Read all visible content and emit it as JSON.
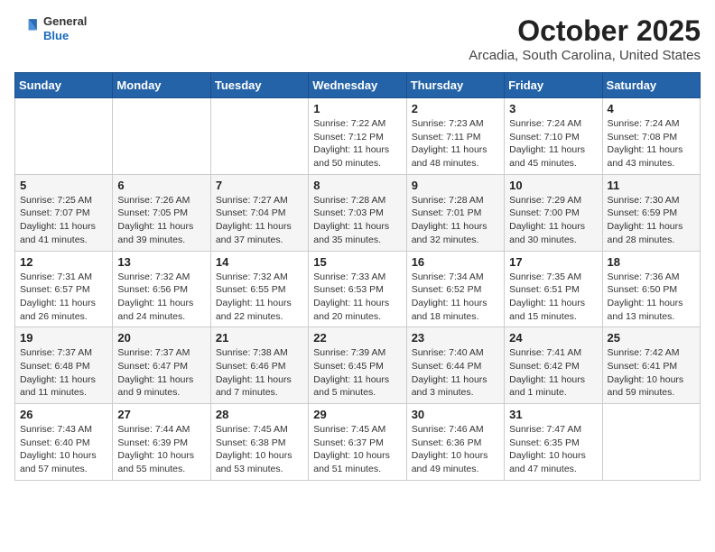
{
  "header": {
    "logo": {
      "general": "General",
      "blue": "Blue"
    },
    "title": "October 2025",
    "location": "Arcadia, South Carolina, United States"
  },
  "weekdays": [
    "Sunday",
    "Monday",
    "Tuesday",
    "Wednesday",
    "Thursday",
    "Friday",
    "Saturday"
  ],
  "weeks": [
    [
      {
        "day": "",
        "info": ""
      },
      {
        "day": "",
        "info": ""
      },
      {
        "day": "",
        "info": ""
      },
      {
        "day": "1",
        "info": "Sunrise: 7:22 AM\nSunset: 7:12 PM\nDaylight: 11 hours and 50 minutes."
      },
      {
        "day": "2",
        "info": "Sunrise: 7:23 AM\nSunset: 7:11 PM\nDaylight: 11 hours and 48 minutes."
      },
      {
        "day": "3",
        "info": "Sunrise: 7:24 AM\nSunset: 7:10 PM\nDaylight: 11 hours and 45 minutes."
      },
      {
        "day": "4",
        "info": "Sunrise: 7:24 AM\nSunset: 7:08 PM\nDaylight: 11 hours and 43 minutes."
      }
    ],
    [
      {
        "day": "5",
        "info": "Sunrise: 7:25 AM\nSunset: 7:07 PM\nDaylight: 11 hours and 41 minutes."
      },
      {
        "day": "6",
        "info": "Sunrise: 7:26 AM\nSunset: 7:05 PM\nDaylight: 11 hours and 39 minutes."
      },
      {
        "day": "7",
        "info": "Sunrise: 7:27 AM\nSunset: 7:04 PM\nDaylight: 11 hours and 37 minutes."
      },
      {
        "day": "8",
        "info": "Sunrise: 7:28 AM\nSunset: 7:03 PM\nDaylight: 11 hours and 35 minutes."
      },
      {
        "day": "9",
        "info": "Sunrise: 7:28 AM\nSunset: 7:01 PM\nDaylight: 11 hours and 32 minutes."
      },
      {
        "day": "10",
        "info": "Sunrise: 7:29 AM\nSunset: 7:00 PM\nDaylight: 11 hours and 30 minutes."
      },
      {
        "day": "11",
        "info": "Sunrise: 7:30 AM\nSunset: 6:59 PM\nDaylight: 11 hours and 28 minutes."
      }
    ],
    [
      {
        "day": "12",
        "info": "Sunrise: 7:31 AM\nSunset: 6:57 PM\nDaylight: 11 hours and 26 minutes."
      },
      {
        "day": "13",
        "info": "Sunrise: 7:32 AM\nSunset: 6:56 PM\nDaylight: 11 hours and 24 minutes."
      },
      {
        "day": "14",
        "info": "Sunrise: 7:32 AM\nSunset: 6:55 PM\nDaylight: 11 hours and 22 minutes."
      },
      {
        "day": "15",
        "info": "Sunrise: 7:33 AM\nSunset: 6:53 PM\nDaylight: 11 hours and 20 minutes."
      },
      {
        "day": "16",
        "info": "Sunrise: 7:34 AM\nSunset: 6:52 PM\nDaylight: 11 hours and 18 minutes."
      },
      {
        "day": "17",
        "info": "Sunrise: 7:35 AM\nSunset: 6:51 PM\nDaylight: 11 hours and 15 minutes."
      },
      {
        "day": "18",
        "info": "Sunrise: 7:36 AM\nSunset: 6:50 PM\nDaylight: 11 hours and 13 minutes."
      }
    ],
    [
      {
        "day": "19",
        "info": "Sunrise: 7:37 AM\nSunset: 6:48 PM\nDaylight: 11 hours and 11 minutes."
      },
      {
        "day": "20",
        "info": "Sunrise: 7:37 AM\nSunset: 6:47 PM\nDaylight: 11 hours and 9 minutes."
      },
      {
        "day": "21",
        "info": "Sunrise: 7:38 AM\nSunset: 6:46 PM\nDaylight: 11 hours and 7 minutes."
      },
      {
        "day": "22",
        "info": "Sunrise: 7:39 AM\nSunset: 6:45 PM\nDaylight: 11 hours and 5 minutes."
      },
      {
        "day": "23",
        "info": "Sunrise: 7:40 AM\nSunset: 6:44 PM\nDaylight: 11 hours and 3 minutes."
      },
      {
        "day": "24",
        "info": "Sunrise: 7:41 AM\nSunset: 6:42 PM\nDaylight: 11 hours and 1 minute."
      },
      {
        "day": "25",
        "info": "Sunrise: 7:42 AM\nSunset: 6:41 PM\nDaylight: 10 hours and 59 minutes."
      }
    ],
    [
      {
        "day": "26",
        "info": "Sunrise: 7:43 AM\nSunset: 6:40 PM\nDaylight: 10 hours and 57 minutes."
      },
      {
        "day": "27",
        "info": "Sunrise: 7:44 AM\nSunset: 6:39 PM\nDaylight: 10 hours and 55 minutes."
      },
      {
        "day": "28",
        "info": "Sunrise: 7:45 AM\nSunset: 6:38 PM\nDaylight: 10 hours and 53 minutes."
      },
      {
        "day": "29",
        "info": "Sunrise: 7:45 AM\nSunset: 6:37 PM\nDaylight: 10 hours and 51 minutes."
      },
      {
        "day": "30",
        "info": "Sunrise: 7:46 AM\nSunset: 6:36 PM\nDaylight: 10 hours and 49 minutes."
      },
      {
        "day": "31",
        "info": "Sunrise: 7:47 AM\nSunset: 6:35 PM\nDaylight: 10 hours and 47 minutes."
      },
      {
        "day": "",
        "info": ""
      }
    ]
  ]
}
